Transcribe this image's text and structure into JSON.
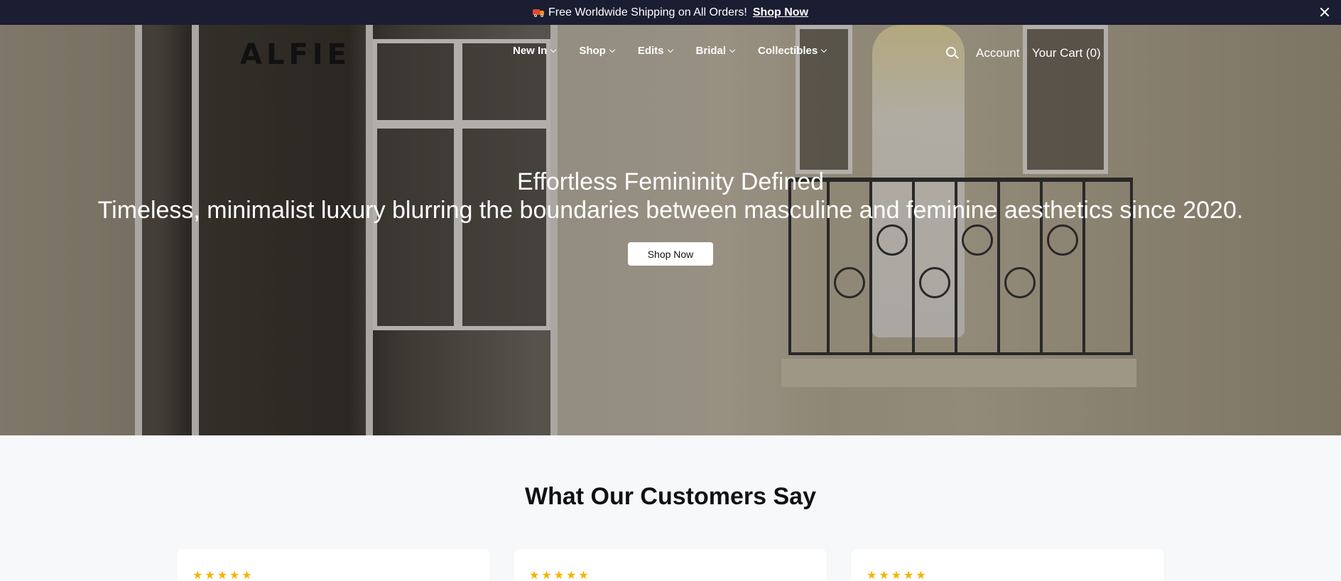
{
  "announcement": {
    "text": "Free Worldwide Shipping on All Orders!",
    "link": "Shop Now",
    "icon": "truck-icon"
  },
  "header": {
    "logo": "ALFIE",
    "nav": [
      {
        "label": "New In"
      },
      {
        "label": "Shop"
      },
      {
        "label": "Edits"
      },
      {
        "label": "Bridal"
      },
      {
        "label": "Collectibles"
      }
    ],
    "account": "Account",
    "cart": "Your Cart (0)"
  },
  "hero": {
    "title": "Effortless Femininity Defined",
    "subtitle": "Timeless, minimalist luxury blurring the boundaries between masculine and feminine aesthetics since 2020.",
    "cta": "Shop Now"
  },
  "reviews": {
    "title": "What Our Customers Say",
    "cards": [
      {
        "stars": "★★★★★"
      },
      {
        "stars": "★★★★★"
      },
      {
        "stars": "★★★★★"
      }
    ]
  },
  "colors": {
    "announcement_bg": "#1b1d33",
    "star": "#f4b400",
    "page_bg": "#f7f8fa"
  }
}
